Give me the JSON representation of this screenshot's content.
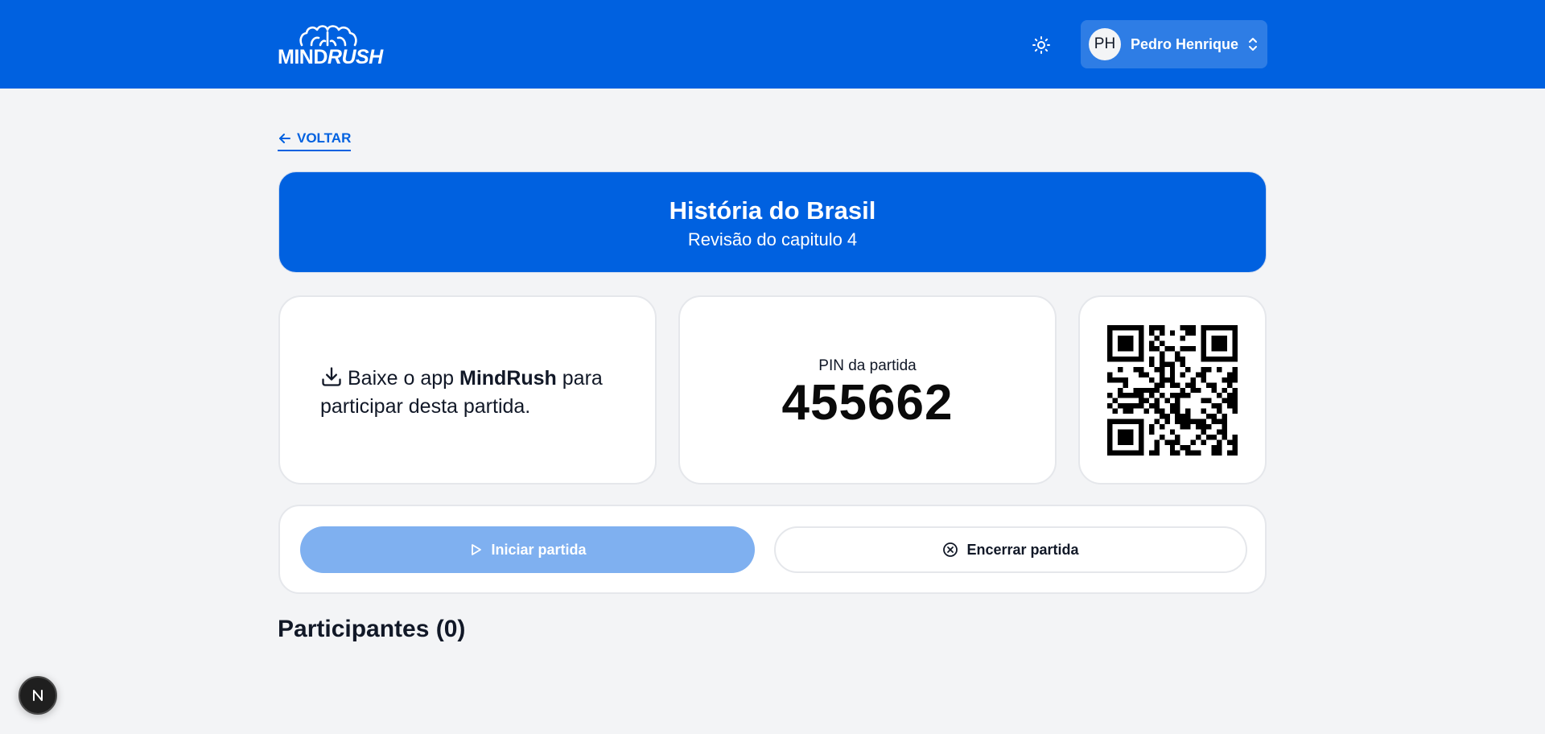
{
  "header": {
    "logo_text_mind": "MIND",
    "logo_text_rush": "RUSH",
    "theme_icon": "sun-icon",
    "user": {
      "initials": "PH",
      "name": "Pedro Henrique"
    }
  },
  "nav": {
    "back_label": "VOLTAR"
  },
  "quiz": {
    "title": "História do Brasil",
    "subtitle": "Revisão do capitulo 4"
  },
  "download": {
    "before": "Baixe o app ",
    "app_name": "MindRush",
    "after": " para participar desta partida."
  },
  "pin": {
    "label": "PIN da partida",
    "value": "455662"
  },
  "actions": {
    "start_label": "Iniciar partida",
    "end_label": "Encerrar partida"
  },
  "participants": {
    "title": "Participantes (0)"
  },
  "badge": {
    "letter": "N"
  },
  "colors": {
    "primary": "#0061e0",
    "start_disabled": "#7fb0f0",
    "background": "#f3f4f6"
  }
}
